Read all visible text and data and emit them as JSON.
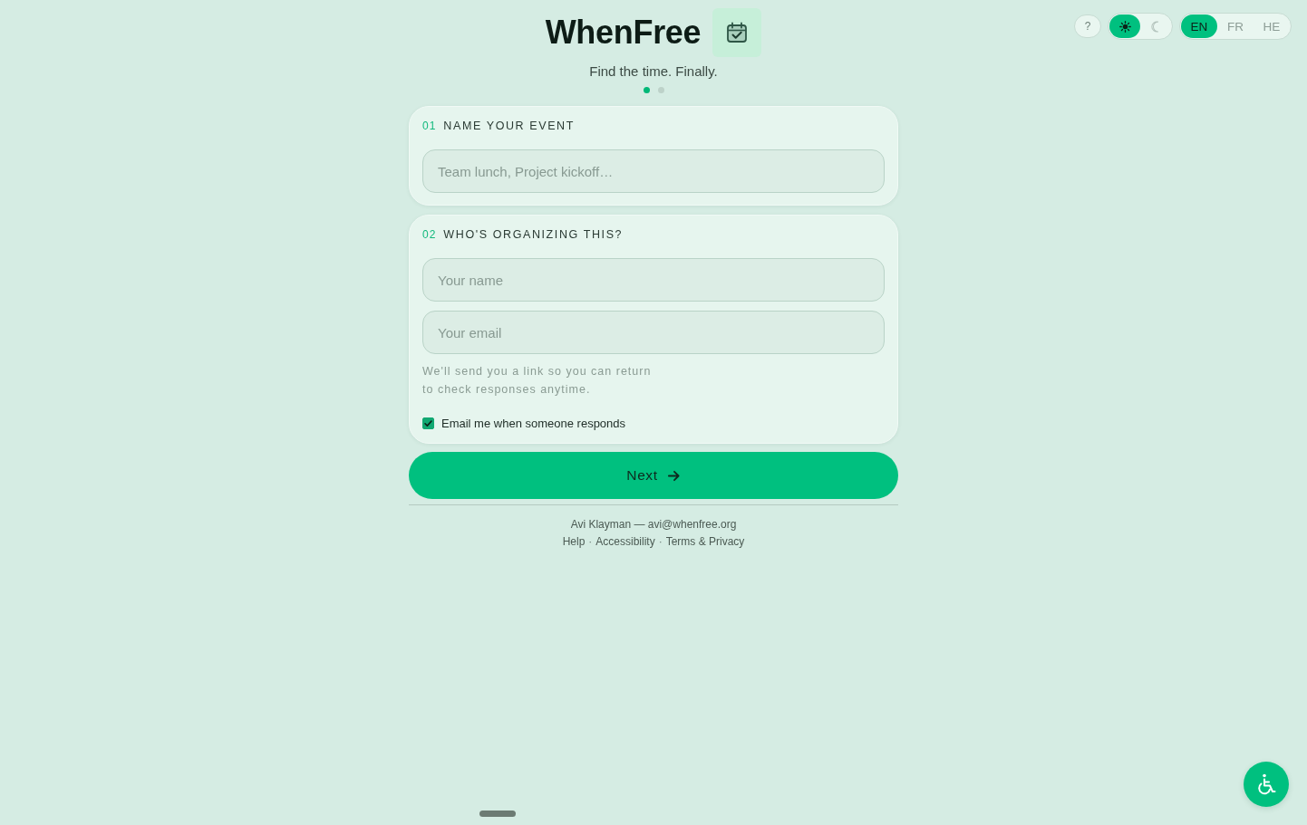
{
  "toolbar": {
    "help": "?",
    "theme_options": [
      {
        "kind": "sun",
        "selected": true
      },
      {
        "kind": "moon",
        "selected": false
      }
    ],
    "languages": [
      {
        "label": "EN",
        "selected": true
      },
      {
        "label": "FR",
        "selected": false
      },
      {
        "label": "HE",
        "selected": false
      }
    ]
  },
  "header": {
    "title": "WhenFree",
    "tagline": "Find the time. Finally.",
    "steps": [
      {
        "selected": true
      },
      {
        "selected": false
      }
    ]
  },
  "sections": [
    {
      "number": "01",
      "title": "NAME YOUR EVENT",
      "fields": [
        {
          "placeholder": "Team lunch, Project kickoff…"
        }
      ]
    },
    {
      "number": "02",
      "title": "WHO'S ORGANIZING THIS?",
      "fields": [
        {
          "placeholder": "Your name"
        },
        {
          "placeholder": "Your email"
        }
      ],
      "hint": "We'll send you a link so you can return to check responses anytime.",
      "checkbox": {
        "label": "Email me when someone responds",
        "checked": true
      }
    }
  ],
  "next_button": {
    "label": "Next"
  },
  "footer": {
    "credit": "Avi Klayman — avi@whenfree.org",
    "links": [
      {
        "label": "Help"
      },
      {
        "label": "Accessibility"
      },
      {
        "label": "Terms & Privacy"
      }
    ],
    "separators": [
      "·",
      "·"
    ]
  }
}
